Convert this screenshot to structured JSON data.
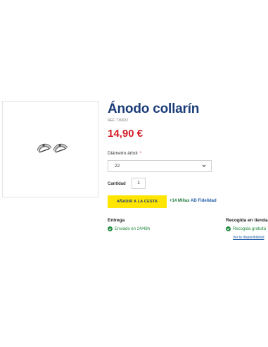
{
  "product": {
    "title": "Ánodo collarín",
    "ref": "REF. T30022",
    "price": "14,90 €",
    "image_alt": "Ánodo collarín"
  },
  "option": {
    "label": "Diámetro árbol",
    "required_mark": "*",
    "selected": "22"
  },
  "quantity": {
    "label": "Cantidad",
    "value": "1"
  },
  "actions": {
    "add_to_cart": "AÑADIR A LA CESTA",
    "miles_points": "+14 Millas",
    "miles_program": "AD Fidelidad"
  },
  "delivery": {
    "shipping_title": "Entrega",
    "shipping_status": "Enviado en 24/48h",
    "pickup_title": "Recogida en tienda",
    "pickup_status": "Recogida gratuita",
    "availability_link": "Ver la disponibilidad"
  },
  "colors": {
    "brand_blue": "#1c3d78",
    "price_red": "#d51f2a",
    "button_yellow": "#ffe500",
    "status_green": "#1f8a3c"
  },
  "icons": [
    "chevron-down-icon",
    "check-circle-icon"
  ]
}
